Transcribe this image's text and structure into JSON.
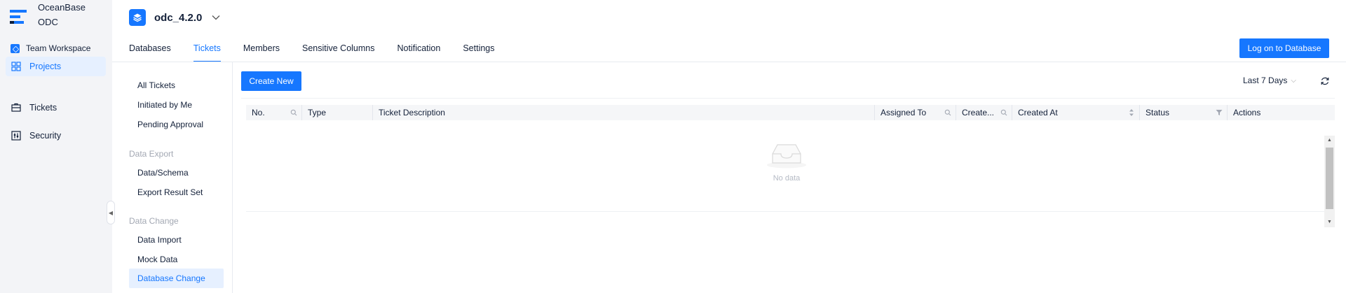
{
  "brand": {
    "line1": "OceanBase",
    "line2": "ODC"
  },
  "workspace": {
    "label": "Team Workspace"
  },
  "global_nav": {
    "items": [
      {
        "label": "Projects",
        "icon": "grid-icon",
        "active": true
      },
      {
        "label": "Tickets",
        "icon": "ticket-icon",
        "active": false
      },
      {
        "label": "Security",
        "icon": "security-icon",
        "active": false
      }
    ]
  },
  "project": {
    "name": "odc_4.2.0"
  },
  "tabs": [
    {
      "label": "Databases",
      "active": false
    },
    {
      "label": "Tickets",
      "active": true
    },
    {
      "label": "Members",
      "active": false
    },
    {
      "label": "Sensitive Columns",
      "active": false
    },
    {
      "label": "Notification",
      "active": false
    },
    {
      "label": "Settings",
      "active": false
    }
  ],
  "header": {
    "login_button": "Log on to Database"
  },
  "subnav": {
    "top_items": [
      "All Tickets",
      "Initiated by Me",
      "Pending Approval"
    ],
    "group_export": "Data Export",
    "export_items": [
      "Data/Schema",
      "Export Result Set"
    ],
    "group_change": "Data Change",
    "change_items": [
      "Data Import",
      "Mock Data",
      "Database Change"
    ],
    "active": "Database Change"
  },
  "toolbar": {
    "create_button": "Create New",
    "time_filter": "Last 7 Days"
  },
  "table": {
    "columns": [
      "No.",
      "Type",
      "Ticket Description",
      "Assigned To",
      "Create...",
      "Created At",
      "Status",
      "Actions"
    ],
    "empty_text": "No data"
  },
  "colors": {
    "accent": "#1677ff",
    "nav_bg": "#f3f4f7",
    "active_bg": "#e6f0ff",
    "text": "#132039"
  }
}
